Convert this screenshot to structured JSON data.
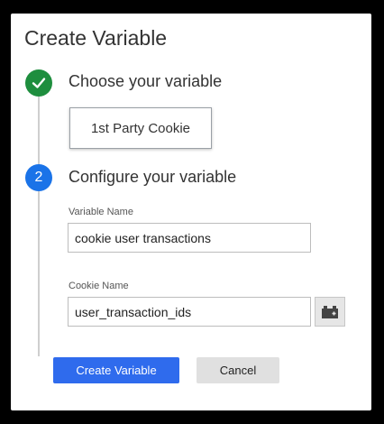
{
  "dialog": {
    "title": "Create Variable"
  },
  "steps": [
    {
      "status": "complete",
      "icon": "check-icon",
      "title": "Choose your variable"
    },
    {
      "status": "active",
      "number": "2",
      "title": "Configure your variable"
    }
  ],
  "variable_type": {
    "label": "1st Party Cookie"
  },
  "fields": {
    "variable_name": {
      "label": "Variable Name",
      "value": "cookie user transactions"
    },
    "cookie_name": {
      "label": "Cookie Name",
      "value": "user_transaction_ids",
      "picker_icon": "variable-picker-icon"
    }
  },
  "buttons": {
    "create_label": "Create Variable",
    "cancel_label": "Cancel"
  },
  "colors": {
    "complete": "#1e8e3e",
    "active": "#1a73e8",
    "primary_button": "#2f6bed"
  }
}
